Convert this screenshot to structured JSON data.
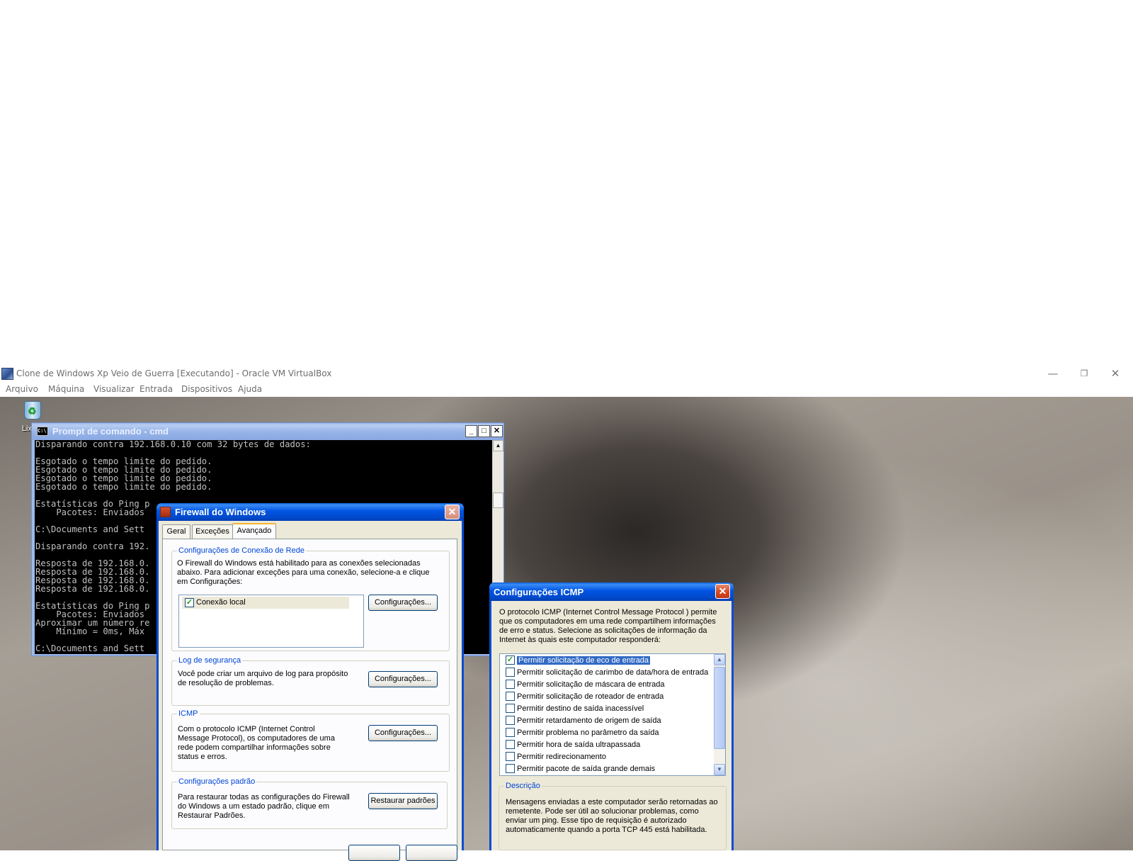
{
  "host": {
    "title": "Clone de Windows Xp Veio de Guerra [Executando] - Oracle VM VirtualBox",
    "menu": [
      "Arquivo",
      "Máquina",
      "Visualizar",
      "Entrada",
      "Dispositivos",
      "Ajuda"
    ],
    "controls": {
      "minimize": "—",
      "restore": "❐",
      "close": "✕"
    }
  },
  "desktop": {
    "recycle_label": "Lix"
  },
  "cmd": {
    "title": "Prompt de comando - cmd",
    "icon_text": "C:\\",
    "lines": [
      "Disparando contra 192.168.0.10 com 32 bytes de dados:",
      "",
      "Esgotado o tempo limite do pedido.",
      "Esgotado o tempo limite do pedido.",
      "Esgotado o tempo limite do pedido.",
      "Esgotado o tempo limite do pedido.",
      "",
      "Estatísticas do Ping p",
      "    Pacotes: Enviados",
      "",
      "C:\\Documents and Sett",
      "",
      "Disparando contra 192.",
      "",
      "Resposta de 192.168.0.",
      "Resposta de 192.168.0.",
      "Resposta de 192.168.0.",
      "Resposta de 192.168.0.",
      "",
      "Estatísticas do Ping p",
      "    Pacotes: Enviados",
      "Aproximar um número re",
      "    Mínimo = 0ms, Máx",
      "",
      "C:\\Documents and Sett"
    ]
  },
  "firewall": {
    "title": "Firewall do Windows",
    "tabs": [
      "Geral",
      "Exceções",
      "Avançado"
    ],
    "active_tab": "Avançado",
    "network": {
      "legend": "Configurações de Conexão de Rede",
      "text": "O Firewall do Windows está habilitado para as conexões selecionadas abaixo. Para adicionar exceções para uma conexão, selecione-a e clique em Configurações:",
      "connection_label": "Conexão local",
      "connection_checked": true,
      "button": "Configurações..."
    },
    "log": {
      "legend": "Log de segurança",
      "text": "Você pode criar um arquivo de log para propósito de resolução de problemas.",
      "button": "Configurações..."
    },
    "icmp": {
      "legend": "ICMP",
      "text": "Com o protocolo ICMP (Internet Control Message Protocol), os computadores de uma rede podem compartilhar informações sobre status e erros.",
      "button": "Configurações..."
    },
    "defaults": {
      "legend": "Configurações padrão",
      "text": "Para restaurar todas as configurações do Firewall do Windows a um estado padrão, clique em Restaurar Padrões.",
      "button": "Restaurar padrões"
    }
  },
  "icmp_dialog": {
    "title": "Configurações ICMP",
    "intro": "O protocolo ICMP (Internet Control Message Protocol ) permite que os computadores em uma rede compartilhem informações de erro e status. Selecione as solicitações de informação da Internet às quais este computador responderá:",
    "options": [
      {
        "label": "Permitir solicitação de eco de entrada",
        "checked": true,
        "selected": true
      },
      {
        "label": "Permitir solicitação de carimbo de data/hora de entrada",
        "checked": false
      },
      {
        "label": "Permitir solicitação de máscara de entrada",
        "checked": false
      },
      {
        "label": "Permitir solicitação de roteador de entrada",
        "checked": false
      },
      {
        "label": "Permitir destino de saída inacessível",
        "checked": false
      },
      {
        "label": "Permitir retardamento de origem de saída",
        "checked": false
      },
      {
        "label": "Permitir problema no parâmetro da saída",
        "checked": false
      },
      {
        "label": "Permitir hora de saída ultrapassada",
        "checked": false
      },
      {
        "label": "Permitir redirecionamento",
        "checked": false
      },
      {
        "label": "Permitir pacote de saída grande demais",
        "checked": false
      }
    ],
    "description": {
      "legend": "Descrição",
      "text": "Mensagens enviadas a este computador serão retornadas ao remetente. Pode ser útil ao solucionar problemas, como enviar um ping. Esse tipo de requisição é autorizado automaticamente quando a porta TCP 445 está habilitada."
    }
  }
}
